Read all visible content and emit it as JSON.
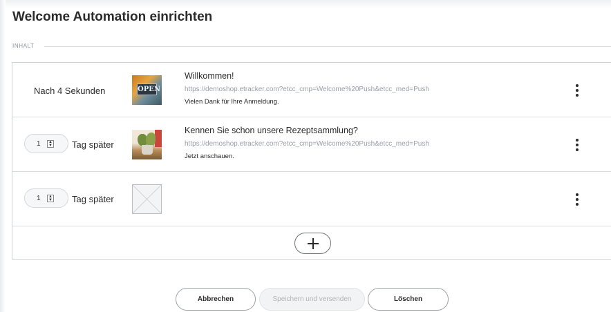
{
  "page": {
    "title": "Welcome Automation einrichten",
    "section_label": "INHALT"
  },
  "rows": [
    {
      "delay_text": "Nach 4 Sekunden",
      "image": "open-sign-image",
      "title": "Willkommen!",
      "url": "https://demoshop.etracker.com?etcc_cmp=Welcome%20Push&etcc_med=Push",
      "text": "Vielen Dank für Ihre Anmeldung."
    },
    {
      "stepper_value": "1",
      "unit_label": "Tag später",
      "image": "plant-image",
      "title": "Kennen Sie schon unsere Rezeptsammlung?",
      "url": "https://demoshop.etracker.com?etcc_cmp=Welcome%20Push&etcc_med=Push",
      "text": "Jetzt anschauen."
    },
    {
      "stepper_value": "1",
      "unit_label": "Tag später",
      "image": "image-placeholder"
    }
  ],
  "actions": {
    "add_icon": "plus-icon",
    "menu_icon": "vertical-dots-icon",
    "cancel": "Abbrechen",
    "save": "Speichern und versenden",
    "delete": "Löschen"
  },
  "colors": {
    "border": "#cfd3d7",
    "muted_text": "#9aa0a6",
    "disabled_button": "#f2f3f4"
  }
}
